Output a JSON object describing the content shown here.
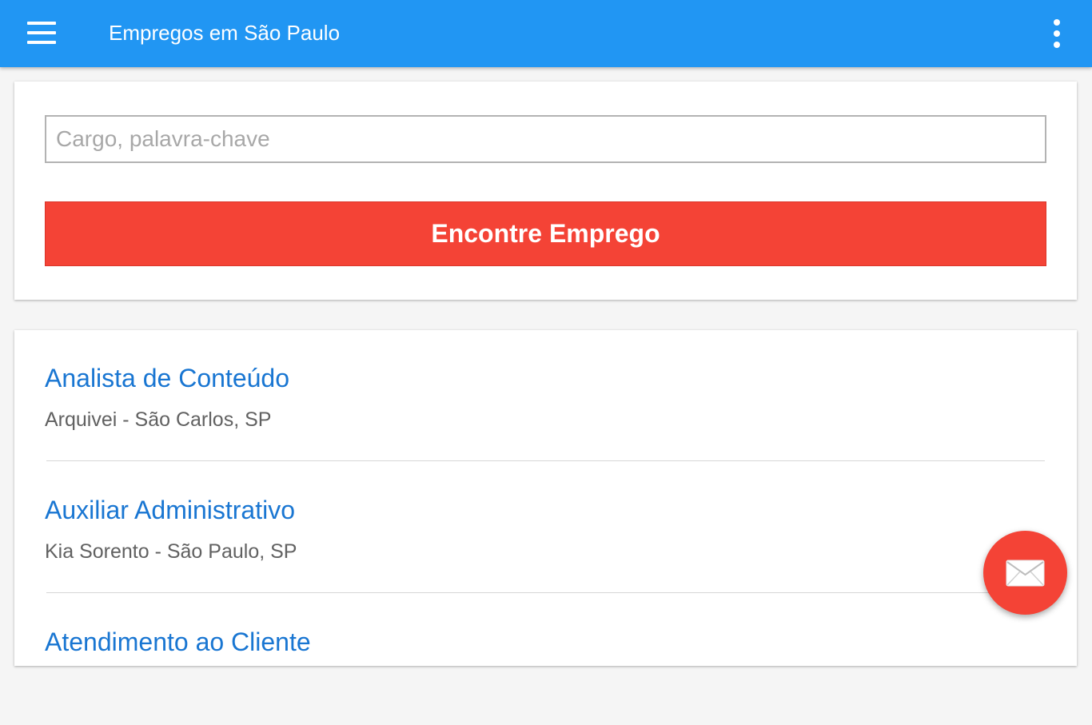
{
  "app_bar": {
    "title": "Empregos em São Paulo",
    "menu_icon": "menu-icon",
    "overflow_icon": "more-vert-icon",
    "background_color": "#2196f3"
  },
  "search": {
    "placeholder": "Cargo, palavra-chave",
    "value": "",
    "button_label": "Encontre Emprego",
    "button_color": "#f44336"
  },
  "jobs": [
    {
      "title": "Analista de Conteúdo",
      "meta": "Arquivei - São Carlos, SP"
    },
    {
      "title": "Auxiliar Administrativo",
      "meta": "Kia Sorento - São Paulo, SP"
    },
    {
      "title": "Atendimento ao Cliente",
      "meta": ""
    }
  ],
  "fab": {
    "icon": "mail-icon",
    "color": "#f44336"
  },
  "colors": {
    "link_title": "#1976d2",
    "meta_text": "#616161",
    "background": "#f5f5f5"
  }
}
